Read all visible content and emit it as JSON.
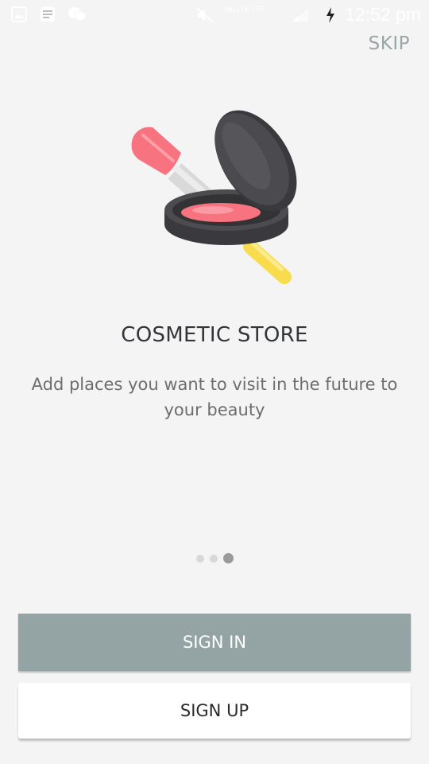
{
  "status_bar": {
    "time": "12:52 pm",
    "icons": [
      "gallery-icon",
      "message-icon",
      "wechat-icon",
      "mute-icon",
      "volte-icon",
      "lte-icon",
      "signal-icon",
      "charging-icon"
    ],
    "volte_label": "Vo) LTE",
    "lte_label": "LTE"
  },
  "onboarding": {
    "skip_label": "SKIP",
    "illustration": "cosmetic-compact-brush-icon",
    "title": "COSMETIC STORE",
    "description": "Add places you want to visit in the future to your beauty",
    "page_count": 3,
    "current_page": 3
  },
  "actions": {
    "sign_in_label": "SIGN IN",
    "sign_up_label": "SIGN UP"
  },
  "colors": {
    "background": "#f4f4f4",
    "sign_in_bg": "#94a4a4",
    "sign_up_bg": "#ffffff",
    "skip_text": "#9aa6a6",
    "title_text": "#333538",
    "description_text": "#6d6d6d",
    "blush_pink": "#f7737f",
    "compact_dark": "#3a3a3e"
  }
}
